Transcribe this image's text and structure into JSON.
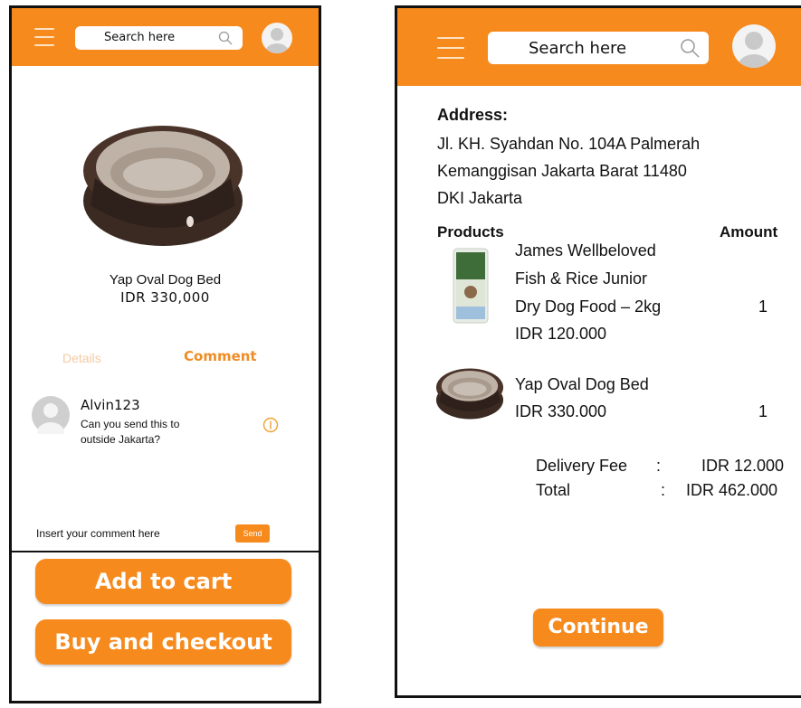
{
  "product_screen": {
    "search": {
      "placeholder": "Search here",
      "icon": "search-icon"
    },
    "product": {
      "name": "Yap Oval Dog Bed",
      "price": "IDR 330,000"
    },
    "tabs": {
      "details": "Details",
      "comment": "Comment"
    },
    "comment": {
      "user": "Alvin123",
      "line1": "Can you send this to",
      "line2": "outside Jakarta?"
    },
    "comment_input": {
      "placeholder": "Insert your comment here",
      "send": "Send"
    },
    "add_to_cart": "Add to cart",
    "buy_checkout": "Buy and checkout"
  },
  "checkout_screen": {
    "search": {
      "placeholder": "Search here",
      "icon": "search-icon"
    },
    "address": {
      "label": "Address:",
      "line1": "Jl. KH. Syahdan No. 104A Palmerah",
      "line2": "Kemanggisan Jakarta Barat 11480",
      "line3": "DKI Jakarta"
    },
    "headers": {
      "products": "Products",
      "amount": "Amount"
    },
    "items": [
      {
        "line1": "James Wellbeloved",
        "line2": "Fish & Rice Junior",
        "line3": "Dry Dog Food – 2kg",
        "price": "IDR 120.000",
        "qty": "1"
      },
      {
        "line1": "Yap Oval Dog Bed",
        "price": "IDR 330.000",
        "qty": "1"
      }
    ],
    "summary": {
      "delivery_label": "Delivery Fee",
      "delivery_sep": ":",
      "delivery_value": "IDR 12.000",
      "total_label": "Total",
      "total_sep": ":",
      "total_value": "IDR 462.000"
    },
    "continue": "Continue"
  },
  "colors": {
    "accent": "#f78a1d",
    "tab_active": "#f08c25",
    "tab_inactive": "#f5c9a1"
  }
}
